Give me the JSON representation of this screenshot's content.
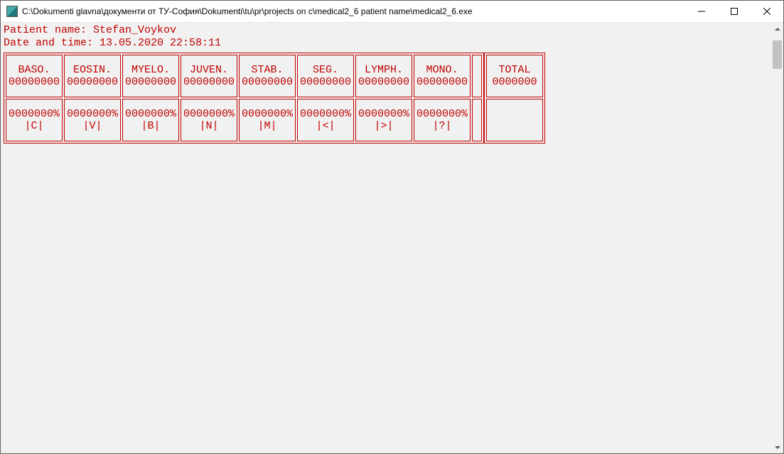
{
  "window": {
    "title": "C:\\Dokumenti glavna\\документи от ТУ-София\\Dokumenti\\tu\\pr\\projects on c\\medical2_6 patient name\\medical2_6.exe"
  },
  "header": {
    "patient_label": "Patient name: ",
    "patient_name": "Stefan_Voykov",
    "datetime_label": "Date and time: ",
    "datetime_value": "13.05.2020 22:58:11"
  },
  "table": {
    "row1": [
      {
        "l1": "BASO.",
        "l2": "00000000"
      },
      {
        "l1": "EOSIN.",
        "l2": "00000000"
      },
      {
        "l1": "MYELO.",
        "l2": "00000000"
      },
      {
        "l1": "JUVEN.",
        "l2": "00000000"
      },
      {
        "l1": "STAB.",
        "l2": "00000000"
      },
      {
        "l1": "SEG.",
        "l2": "00000000"
      },
      {
        "l1": "LYMPH.",
        "l2": "00000000"
      },
      {
        "l1": "MONO.",
        "l2": "00000000"
      }
    ],
    "row2": [
      {
        "l1": "0000000%",
        "l2": "|C|"
      },
      {
        "l1": "0000000%",
        "l2": "|V|"
      },
      {
        "l1": "0000000%",
        "l2": "|B|"
      },
      {
        "l1": "0000000%",
        "l2": "|N|"
      },
      {
        "l1": "0000000%",
        "l2": "|M|"
      },
      {
        "l1": "0000000%",
        "l2": "|<|"
      },
      {
        "l1": "0000000%",
        "l2": "|>|"
      },
      {
        "l1": "0000000%",
        "l2": "|?|"
      }
    ],
    "total": {
      "l1": "TOTAL",
      "l2": "0000000"
    }
  }
}
